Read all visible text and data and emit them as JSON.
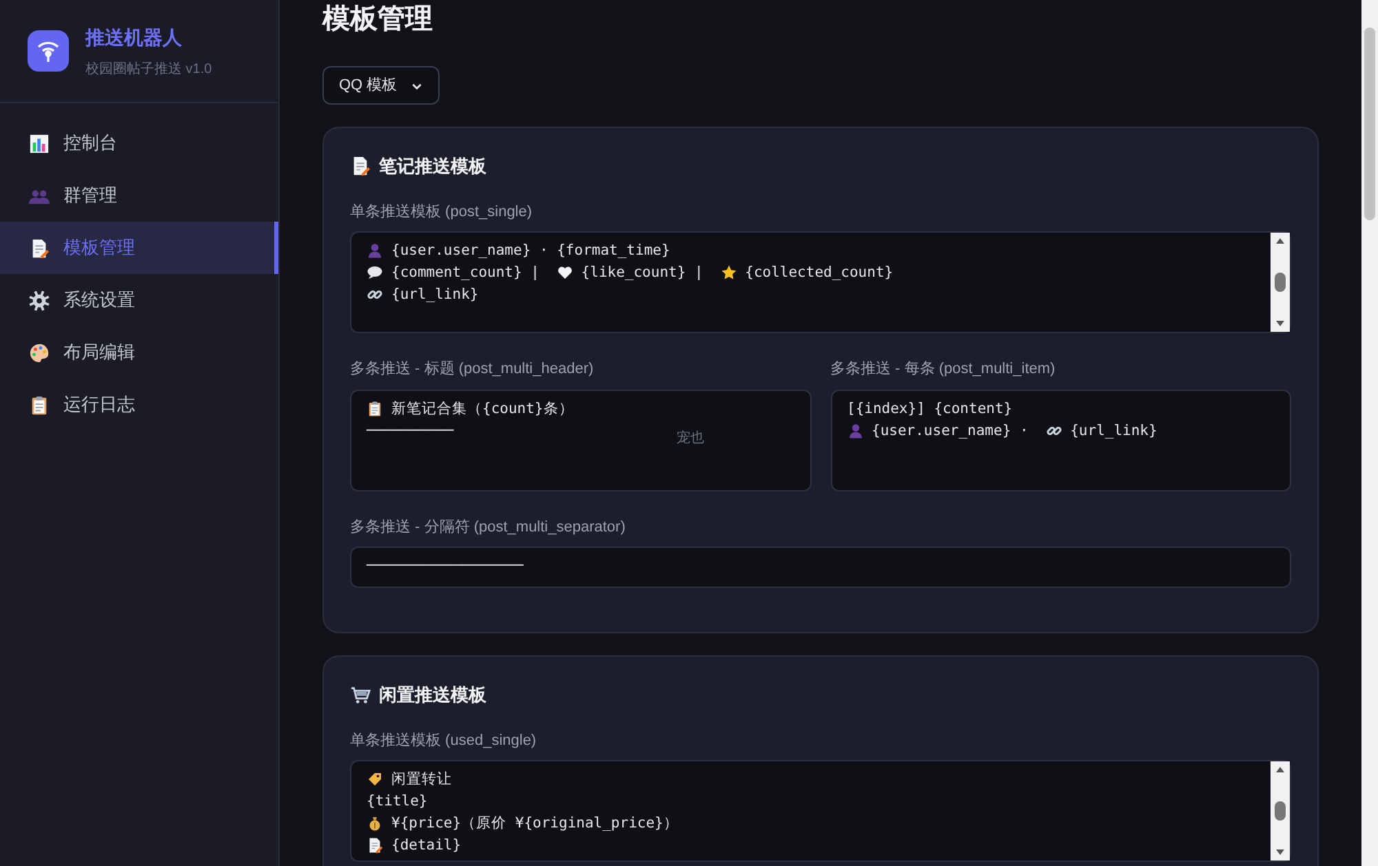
{
  "sidebar": {
    "brand": {
      "title": "推送机器人",
      "subtitle": "校园圈帖子推送 v1.0"
    },
    "items": [
      {
        "label": "控制台",
        "selected": false
      },
      {
        "label": "群管理",
        "selected": false
      },
      {
        "label": "模板管理",
        "selected": true
      },
      {
        "label": "系统设置",
        "selected": false
      },
      {
        "label": "布局编辑",
        "selected": false
      },
      {
        "label": "运行日志",
        "selected": false
      }
    ]
  },
  "page": {
    "title": "模板管理",
    "platform_select": "QQ 模板"
  },
  "sections": [
    {
      "title": "笔记推送模板",
      "rows": [
        [
          {
            "label": "单条推送模板 (post_single)",
            "scrollable": true,
            "lines": [
              [
                {
                  "kind": "icon"
                },
                {
                  "kind": "text",
                  "text": "{user.user_name} · {format_time}"
                }
              ],
              [
                {
                  "kind": "icon"
                },
                {
                  "kind": "text",
                  "text": "{comment_count} | "
                },
                {
                  "kind": "icon"
                },
                {
                  "kind": "text",
                  "text": "{like_count} | "
                },
                {
                  "kind": "icon"
                },
                {
                  "kind": "text",
                  "text": "{collected_count}"
                }
              ],
              [
                {
                  "kind": "icon"
                },
                {
                  "kind": "text",
                  "text": "{url_link}"
                }
              ]
            ]
          }
        ],
        [
          {
            "label": "多条推送 - 标题 (post_multi_header)",
            "scrollable": false,
            "overlay_text": "宠也",
            "lines": [
              [
                {
                  "kind": "icon"
                },
                {
                  "kind": "text",
                  "text": "新笔记合集（{count}条）"
                }
              ],
              [
                {
                  "kind": "text",
                  "text": "──────────"
                }
              ]
            ]
          },
          {
            "label": "多条推送 - 每条 (post_multi_item)",
            "scrollable": false,
            "lines": [
              [
                {
                  "kind": "text",
                  "text": "[{index}] {content}"
                }
              ],
              [
                {
                  "kind": "icon"
                },
                {
                  "kind": "text",
                  "text": "{user.user_name} · "
                },
                {
                  "kind": "icon"
                },
                {
                  "kind": "text",
                  "text": "{url_link}"
                }
              ]
            ]
          }
        ],
        [
          {
            "label": "多条推送 - 分隔符 (post_multi_separator)",
            "scrollable": false,
            "single": true,
            "lines": [
              [
                {
                  "kind": "text",
                  "text": "──────────────────"
                }
              ]
            ]
          }
        ]
      ]
    },
    {
      "title": "闲置推送模板",
      "rows": [
        [
          {
            "label": "单条推送模板 (used_single)",
            "scrollable": true,
            "lines": [
              [
                {
                  "kind": "icon"
                },
                {
                  "kind": "text",
                  "text": "闲置转让"
                }
              ],
              [
                {
                  "kind": "text",
                  "text": "{title}"
                }
              ],
              [
                {
                  "kind": "icon"
                },
                {
                  "kind": "text",
                  "text": "¥{price}（原价 ¥{original_price}）"
                }
              ],
              [
                {
                  "kind": "icon"
                },
                {
                  "kind": "text",
                  "text": "{detail}"
                }
              ]
            ]
          }
        ]
      ]
    }
  ]
}
